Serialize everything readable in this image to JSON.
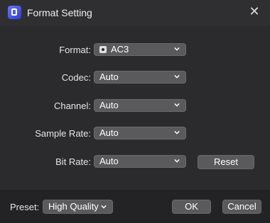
{
  "window": {
    "title": "Format Setting",
    "close_glyph": "✕"
  },
  "rows": {
    "format": {
      "label": "Format:",
      "value": "AC3",
      "icon": "audio-file-icon"
    },
    "codec": {
      "label": "Codec:",
      "value": "Auto"
    },
    "channel": {
      "label": "Channel:",
      "value": "Auto"
    },
    "sample_rate": {
      "label": "Sample Rate:",
      "value": "Auto"
    },
    "bit_rate": {
      "label": "Bit Rate:",
      "value": "Auto"
    }
  },
  "buttons": {
    "reset": "Reset",
    "ok": "OK",
    "cancel": "Cancel"
  },
  "preset": {
    "label": "Preset:",
    "value": "High Quality"
  },
  "colors": {
    "background": "#2b2b2d",
    "control": "#5a5a5c",
    "footer": "#232325",
    "accent": "#4a5cff"
  }
}
